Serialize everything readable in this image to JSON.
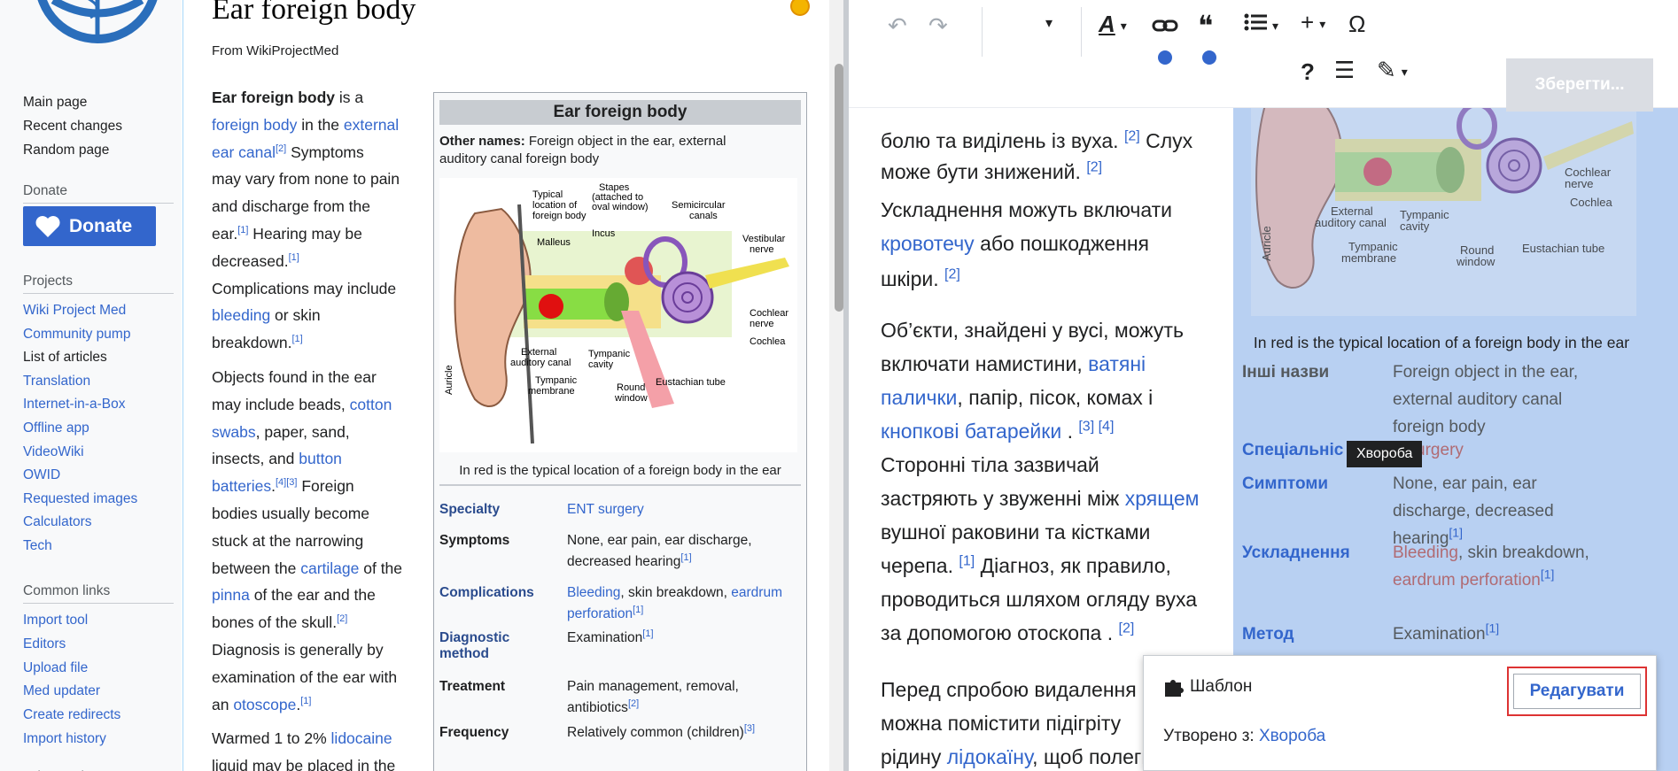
{
  "left": {
    "sidebar": {
      "nav": [
        "Main page",
        "Recent changes",
        "Random page"
      ],
      "donate_heading": "Donate",
      "donate_label": "Donate",
      "projects_heading": "Projects",
      "projects": [
        "Wiki Project Med",
        "Community pump",
        "List of articles",
        "Translation",
        "Internet-in-a-Box",
        "Offline app",
        "VideoWiki",
        "OWID",
        "Requested images",
        "Calculators",
        "Tech"
      ],
      "common_heading": "Common links",
      "common": [
        "Import tool",
        "Editors",
        "Upload file",
        "Med updater",
        "Create redirects",
        "Import history"
      ],
      "other_heading": "Other projects"
    },
    "article": {
      "title": "Ear foreign body",
      "from": "From WikiProjectMed",
      "lines": [
        [
          {
            "b": "Ear foreign body"
          },
          {
            "t": " is a"
          }
        ],
        [
          {
            "a": "foreign body"
          },
          {
            "t": " in the "
          },
          {
            "a": "external"
          }
        ],
        [
          {
            "a": "ear canal"
          },
          {
            "s": "[2]"
          },
          {
            "t": " Symptoms"
          }
        ],
        [
          {
            "t": "may vary from none to pain"
          }
        ],
        [
          {
            "t": "and discharge from the"
          }
        ],
        [
          {
            "t": "ear."
          },
          {
            "s": "[1]"
          },
          {
            "t": " Hearing may be"
          }
        ],
        [
          {
            "t": "decreased."
          },
          {
            "s": "[1]"
          }
        ],
        [
          {
            "t": "Complications may include"
          }
        ],
        [
          {
            "a": "bleeding"
          },
          {
            "t": " or skin"
          }
        ],
        [
          {
            "t": "breakdown."
          },
          {
            "s": "[1]"
          }
        ],
        [
          {
            "t": "Objects found in the ear"
          }
        ],
        [
          {
            "t": "may include beads, "
          },
          {
            "a": "cotton"
          }
        ],
        [
          {
            "a": "swabs"
          },
          {
            "t": ", paper, sand,"
          }
        ],
        [
          {
            "t": "insects, and "
          },
          {
            "a": "button"
          }
        ],
        [
          {
            "a": "batteries"
          },
          {
            "t": "."
          },
          {
            "s": "[4][3]"
          },
          {
            "t": " Foreign"
          }
        ],
        [
          {
            "t": "bodies usually become"
          }
        ],
        [
          {
            "t": "stuck at the narrowing"
          }
        ],
        [
          {
            "t": "between the "
          },
          {
            "a": "cartilage"
          },
          {
            "t": " of the"
          }
        ],
        [
          {
            "a": "pinna"
          },
          {
            "t": " of the ear and the"
          }
        ],
        [
          {
            "t": "bones of the skull."
          },
          {
            "s": "[2]"
          }
        ],
        [
          {
            "t": "Diagnosis is generally by"
          }
        ],
        [
          {
            "t": "examination of the ear with"
          }
        ],
        [
          {
            "t": "an "
          },
          {
            "a": "otoscope"
          },
          {
            "t": "."
          },
          {
            "s": "[1]"
          }
        ],
        [
          {
            "t": "Warmed 1 to 2% "
          },
          {
            "a": "lidocaine"
          }
        ],
        [
          {
            "t": "liquid may be placed in the"
          }
        ]
      ]
    },
    "infobox": {
      "title": "Ear foreign body",
      "other_names_label": "Other names:",
      "other_names_1": " Foreign object in the ear, external",
      "other_names_2": "auditory canal foreign body",
      "image_labels": {
        "typical": [
          "Typical",
          "location of",
          "foreign body"
        ],
        "stapes": [
          "Stapes",
          "(attached to",
          "oval window)"
        ],
        "semicircular": [
          "Semicircular",
          "canals"
        ],
        "malleus": "Malleus",
        "incus": "Incus",
        "vestibular": [
          "Vestibular",
          "nerve"
        ],
        "cochlear_nerve": [
          "Cochlear",
          "nerve"
        ],
        "cochlea": "Cochlea",
        "external": [
          "External",
          "auditory canal"
        ],
        "tympanic_cavity": [
          "Tympanic",
          "cavity"
        ],
        "tympanic_membrane": [
          "Tympanic",
          "membrane"
        ],
        "round_window": [
          "Round",
          "window"
        ],
        "eustachian": "Eustachian tube",
        "auricle": "Auricle"
      },
      "caption": "In red is the typical location of a foreign body in the ear",
      "rows": [
        {
          "label": "Specialty",
          "link": true,
          "lines": [
            [
              {
                "a": "ENT surgery"
              }
            ]
          ]
        },
        {
          "label": "Symptoms",
          "link": false,
          "lines": [
            [
              {
                "t": "None, ear pain, ear discharge,"
              }
            ],
            [
              {
                "t": "decreased hearing"
              },
              {
                "s": "[1]"
              }
            ]
          ]
        },
        {
          "label": "Complications",
          "link": true,
          "lines": [
            [
              {
                "a": "Bleeding"
              },
              {
                "t": ", skin breakdown, "
              },
              {
                "a": "eardrum"
              }
            ],
            [
              {
                "a": "perforation"
              },
              {
                "s": "[1]"
              }
            ]
          ]
        },
        {
          "label": "Diagnostic",
          "label2": "method",
          "link": true,
          "lines": [
            [
              {
                "t": "Examination"
              },
              {
                "s": "[1]"
              }
            ]
          ]
        },
        {
          "label": "Treatment",
          "link": false,
          "lines": [
            [
              {
                "t": "Pain management, removal,"
              }
            ],
            [
              {
                "t": "antibiotics"
              },
              {
                "s": "[2]"
              }
            ]
          ]
        },
        {
          "label": "Frequency",
          "link": false,
          "lines": [
            [
              {
                "t": "Relatively common (children)"
              },
              {
                "s": "[3]"
              }
            ]
          ]
        }
      ]
    }
  },
  "right": {
    "toolbar": {
      "text_style": "A",
      "link": "link",
      "quote": "❝",
      "list": "list",
      "insert": "+",
      "special_chars": "Ω",
      "help": "?",
      "save_label": "Зберегти..."
    },
    "lines": [
      [
        {
          "t": "болю та виділень із вуха. "
        },
        {
          "s": "[2]"
        },
        {
          "t": " Слух"
        }
      ],
      [
        {
          "t": "може бути знижений. "
        },
        {
          "s": "[2]"
        }
      ],
      [
        {
          "t": "Ускладнення можуть включати"
        }
      ],
      [
        {
          "a": "кровотечу"
        },
        {
          "t": " або пошкодження"
        }
      ],
      [
        {
          "t": "шкіри. "
        },
        {
          "s": "[2]"
        }
      ],
      [
        {
          "t": "Об’єкти, знайдені у вусі, можуть"
        }
      ],
      [
        {
          "t": "включати намистини, "
        },
        {
          "a": "ватяні"
        }
      ],
      [
        {
          "a": "палички"
        },
        {
          "t": ", папір, пісок, комах і"
        }
      ],
      [
        {
          "a": "кнопкові батарейки"
        },
        {
          "t": " . "
        },
        {
          "s": "[3] [4]"
        }
      ],
      [
        {
          "t": "Сторонні тіла зазвичай"
        }
      ],
      [
        {
          "t": "застряють у звуженні між "
        },
        {
          "a": "хрящем"
        }
      ],
      [
        {
          "t": "вушної раковини та кістками"
        }
      ],
      [
        {
          "t": "черепа. "
        },
        {
          "s": "[1]"
        },
        {
          "t": " Діагноз, як правило,"
        }
      ],
      [
        {
          "t": "проводиться шляхом огляду вуха"
        }
      ],
      [
        {
          "t": "за допомогою отоскопа . "
        },
        {
          "s": "[2]"
        }
      ],
      [
        {
          "t": "Перед спробою видалення"
        }
      ],
      [
        {
          "t": "можна помістити підігрiту"
        }
      ],
      [
        {
          "t": "рідину "
        },
        {
          "a": "лідокаїну"
        },
        {
          "t": ", щоб полегшити"
        }
      ]
    ],
    "infobox": {
      "caption": "In red is the typical location of a foreign body in the ear",
      "rows": [
        {
          "label": "Інші назви",
          "link": false,
          "lines": [
            [
              {
                "t": "Foreign object in the ear,"
              }
            ],
            [
              {
                "t": "external auditory canal"
              }
            ],
            [
              {
                "t": "foreign body"
              }
            ]
          ]
        },
        {
          "label": "Спеціальніс",
          "link": true,
          "lines": [
            [
              {
                "r": "T surgery"
              }
            ]
          ]
        },
        {
          "label": "Симптоми",
          "link": true,
          "lines": [
            [
              {
                "t": "None, ear pain, ear"
              }
            ],
            [
              {
                "t": "discharge, decreased"
              }
            ],
            [
              {
                "t": "hearing"
              },
              {
                "s": "[1]"
              }
            ]
          ]
        },
        {
          "label": "Ускладнення",
          "link": true,
          "lines": [
            [
              {
                "r": "Bleeding"
              },
              {
                "t": ", skin breakdown,"
              }
            ],
            [
              {
                "r": "eardrum perforation"
              },
              {
                "s": "[1]"
              }
            ]
          ]
        },
        {
          "label": "Метод",
          "link": true,
          "lines": [
            [
              {
                "t": "Examination"
              },
              {
                "s": "[1]"
              }
            ]
          ]
        }
      ]
    },
    "tooltip": "Хвороба",
    "template_popup": {
      "label": "Шаблон",
      "edit_label": "Редагувати",
      "created_from_label": "Утворено з: ",
      "created_from_link": "Хвороба"
    }
  },
  "colors": {
    "link": "#3366cc",
    "highlight": "#b8d0f2",
    "donate": "#3366cc",
    "focus_outline": "#dd3333"
  }
}
